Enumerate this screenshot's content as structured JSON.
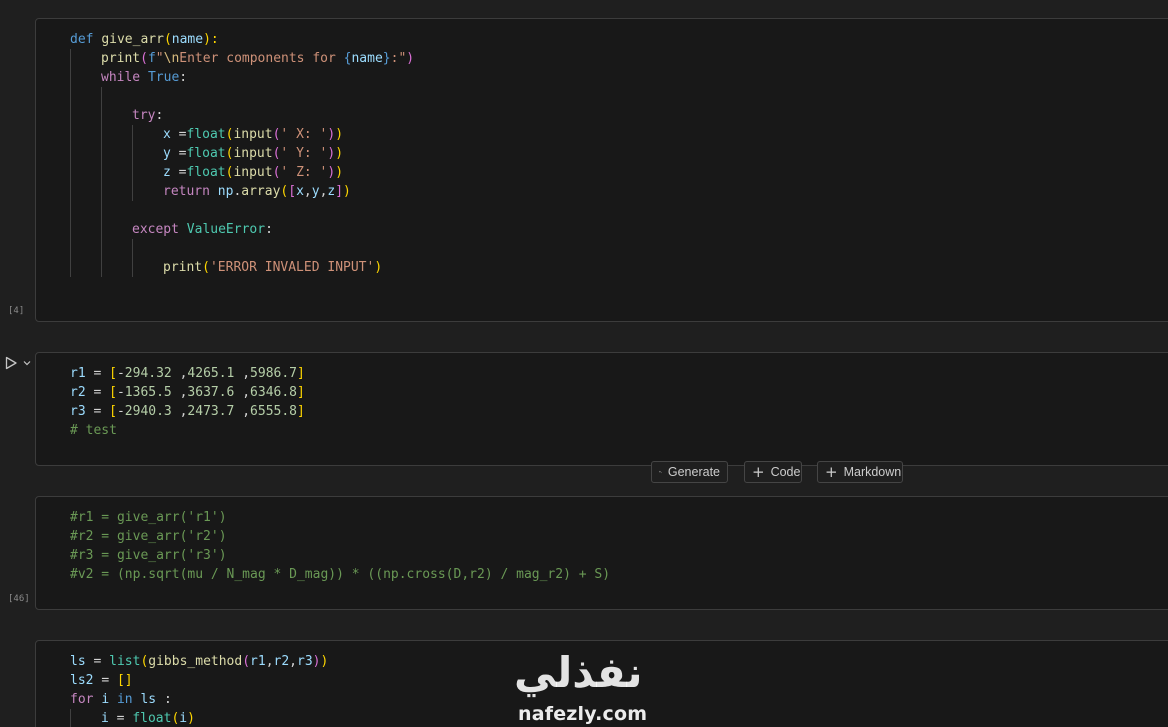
{
  "cells": [
    {
      "id": "cell-1",
      "exec_count": "[4]",
      "lines": [
        [
          [
            "kw",
            "def "
          ],
          [
            "fn",
            "give_arr"
          ],
          [
            "p1",
            "("
          ],
          [
            "var",
            "name"
          ],
          [
            "p1",
            "):"
          ]
        ],
        [
          [
            "fn",
            "print"
          ],
          [
            "p2",
            "("
          ],
          [
            "kw",
            "f"
          ],
          [
            "str",
            "\""
          ],
          [
            "esc",
            "\\n"
          ],
          [
            "str",
            "Enter components for "
          ],
          [
            "kw",
            "{"
          ],
          [
            "var",
            "name"
          ],
          [
            "kw",
            "}"
          ],
          [
            "str",
            ":\""
          ],
          [
            "p2",
            ")"
          ]
        ],
        [
          [
            "ctl",
            "while "
          ],
          [
            "kw",
            "True"
          ],
          [
            "plain",
            ":"
          ]
        ],
        [],
        [
          [
            "ctl",
            "try"
          ],
          [
            "plain",
            ":"
          ]
        ],
        [
          [
            "var",
            "x "
          ],
          [
            "op",
            "="
          ],
          [
            "builtin",
            "float"
          ],
          [
            "p1",
            "("
          ],
          [
            "fn",
            "input"
          ],
          [
            "p2",
            "("
          ],
          [
            "str",
            "' X: '"
          ],
          [
            "p2",
            ")"
          ],
          [
            "p1",
            ")"
          ]
        ],
        [
          [
            "var",
            "y "
          ],
          [
            "op",
            "="
          ],
          [
            "builtin",
            "float"
          ],
          [
            "p1",
            "("
          ],
          [
            "fn",
            "input"
          ],
          [
            "p2",
            "("
          ],
          [
            "str",
            "' Y: '"
          ],
          [
            "p2",
            ")"
          ],
          [
            "p1",
            ")"
          ]
        ],
        [
          [
            "var",
            "z "
          ],
          [
            "op",
            "="
          ],
          [
            "builtin",
            "float"
          ],
          [
            "p1",
            "("
          ],
          [
            "fn",
            "input"
          ],
          [
            "p2",
            "("
          ],
          [
            "str",
            "' Z: '"
          ],
          [
            "p2",
            ")"
          ],
          [
            "p1",
            ")"
          ]
        ],
        [
          [
            "ctl",
            "return "
          ],
          [
            "var",
            "np"
          ],
          [
            "plain",
            "."
          ],
          [
            "fn",
            "array"
          ],
          [
            "p1",
            "("
          ],
          [
            "p2",
            "["
          ],
          [
            "var",
            "x"
          ],
          [
            "plain",
            ","
          ],
          [
            "var",
            "y"
          ],
          [
            "plain",
            ","
          ],
          [
            "var",
            "z"
          ],
          [
            "p2",
            "]"
          ],
          [
            "p1",
            ")"
          ]
        ],
        [],
        [
          [
            "ctl",
            "except "
          ],
          [
            "cls",
            "ValueError"
          ],
          [
            "plain",
            ":"
          ]
        ],
        [],
        [
          [
            "fn",
            "print"
          ],
          [
            "p1",
            "("
          ],
          [
            "str",
            "'ERROR INVALED INPUT'"
          ],
          [
            "p1",
            ")"
          ]
        ]
      ]
    },
    {
      "id": "cell-2",
      "exec_count": "",
      "lines": [
        [
          [
            "var",
            "r1 "
          ],
          [
            "op",
            "= "
          ],
          [
            "p1",
            "["
          ],
          [
            "op",
            "-"
          ],
          [
            "num",
            "294.32"
          ],
          [
            "plain",
            " ,"
          ],
          [
            "num",
            "4265.1"
          ],
          [
            "plain",
            " ,"
          ],
          [
            "num",
            "5986.7"
          ],
          [
            "p1",
            "]"
          ]
        ],
        [
          [
            "var",
            "r2 "
          ],
          [
            "op",
            "= "
          ],
          [
            "p1",
            "["
          ],
          [
            "op",
            "-"
          ],
          [
            "num",
            "1365.5"
          ],
          [
            "plain",
            " ,"
          ],
          [
            "num",
            "3637.6"
          ],
          [
            "plain",
            " ,"
          ],
          [
            "num",
            "6346.8"
          ],
          [
            "p1",
            "]"
          ]
        ],
        [
          [
            "var",
            "r3 "
          ],
          [
            "op",
            "= "
          ],
          [
            "p1",
            "["
          ],
          [
            "op",
            "-"
          ],
          [
            "num",
            "2940.3"
          ],
          [
            "plain",
            " ,"
          ],
          [
            "num",
            "2473.7"
          ],
          [
            "plain",
            " ,"
          ],
          [
            "num",
            "6555.8"
          ],
          [
            "p1",
            "]"
          ]
        ],
        [
          [
            "cmt",
            "# test"
          ]
        ]
      ]
    },
    {
      "id": "cell-3",
      "exec_count": "[46]",
      "lines": [
        [
          [
            "cmt",
            "#r1 = give_arr('r1')"
          ]
        ],
        [
          [
            "cmt",
            "#r2 = give_arr('r2')"
          ]
        ],
        [
          [
            "cmt",
            "#r3 = give_arr('r3')"
          ]
        ],
        [
          [
            "cmt",
            "#v2 = (np.sqrt(mu / N_mag * D_mag)) * ((np.cross(D,r2) / mag_r2) + S)"
          ]
        ]
      ]
    },
    {
      "id": "cell-4",
      "exec_count": "",
      "lines": [
        [
          [
            "var",
            "ls "
          ],
          [
            "op",
            "= "
          ],
          [
            "builtin",
            "list"
          ],
          [
            "p1",
            "("
          ],
          [
            "fn",
            "gibbs_method"
          ],
          [
            "p2",
            "("
          ],
          [
            "var",
            "r1"
          ],
          [
            "plain",
            ","
          ],
          [
            "var",
            "r2"
          ],
          [
            "plain",
            ","
          ],
          [
            "var",
            "r3"
          ],
          [
            "p2",
            ")"
          ],
          [
            "p1",
            ")"
          ]
        ],
        [
          [
            "var",
            "ls2 "
          ],
          [
            "op",
            "= "
          ],
          [
            "p1",
            "[]"
          ]
        ],
        [
          [
            "ctl",
            "for "
          ],
          [
            "var",
            "i "
          ],
          [
            "kw",
            "in "
          ],
          [
            "var",
            "ls "
          ],
          [
            "plain",
            ":"
          ]
        ],
        [
          [
            "var",
            "i "
          ],
          [
            "op",
            "= "
          ],
          [
            "builtin",
            "float"
          ],
          [
            "p1",
            "("
          ],
          [
            "var",
            "i"
          ],
          [
            "p1",
            ")"
          ]
        ]
      ]
    }
  ],
  "toolbar": {
    "generate_label": "Generate",
    "code_label": "Code",
    "markdown_label": "Markdown"
  },
  "watermark": {
    "arabic_text": "نفذلي",
    "latin_text": "nafezly.com"
  },
  "icons": {
    "run": "play-icon",
    "run_menu": "chevron-down-icon",
    "generate": "sparkle-icon",
    "add": "plus-icon"
  },
  "colors": {
    "background": "#1f1f1f",
    "cell_background": "#181818",
    "cell_border": "#3c3c3c",
    "keyword": "#569cd6",
    "control": "#c586c0",
    "function": "#dcdcaa",
    "variable": "#9cdcfe",
    "string": "#ce9178",
    "number": "#b5cea8",
    "comment": "#6a9955"
  }
}
